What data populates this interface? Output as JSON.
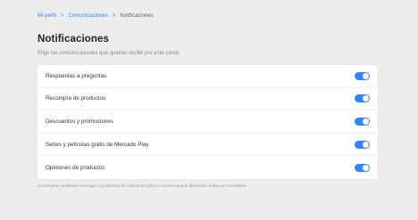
{
  "breadcrumb": {
    "items": [
      "Mi perfil",
      "Comunicaciones",
      "Notificaciones"
    ],
    "separator": ">"
  },
  "page": {
    "title": "Notificaciones",
    "subtitle": "Elige las comunicaciones que quieres recibir por este canal."
  },
  "settings": [
    {
      "label": "Respuestas a preguntas",
      "enabled": true
    },
    {
      "label": "Recompra de productos",
      "enabled": true
    },
    {
      "label": "Descuentos y promociones",
      "enabled": true
    },
    {
      "label": "Series y películas gratis de Mercado Play",
      "enabled": true
    },
    {
      "label": "Opiniones de productos",
      "enabled": true
    }
  ],
  "footnote": "Continuarás recibiendo mensajes con información relevante sobre tu cuenta aunque desactives todas las novedades.",
  "colors": {
    "accent": "#3483fa",
    "background": "#ededed"
  }
}
